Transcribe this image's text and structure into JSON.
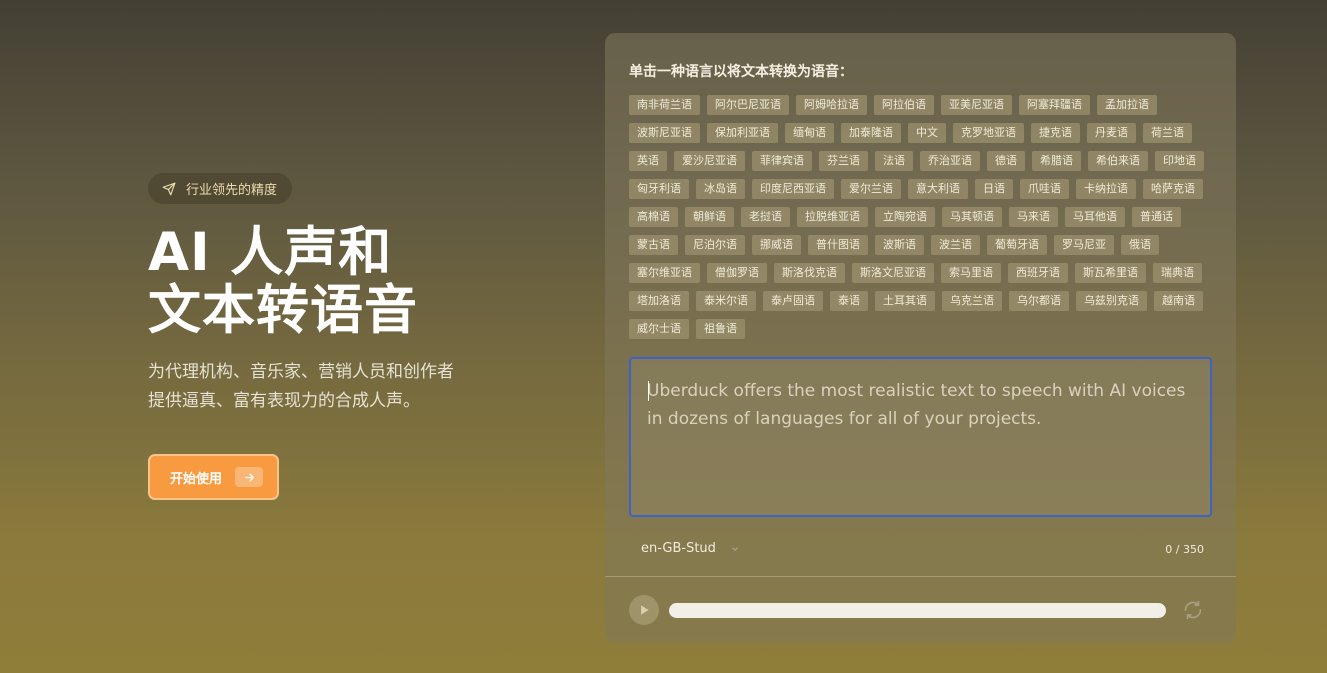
{
  "hero": {
    "badge": "行业领先的精度",
    "title_line1": "AI 人声和",
    "title_line2": "文本转语音",
    "description": "为代理机构、音乐家、营销人员和创作者提供逼真、富有表现力的合成人声。",
    "cta": "开始使用",
    "cta_color": "#f79a40"
  },
  "panel": {
    "title": "单击一种语言以将文本转换为语音：",
    "languages": [
      "南非荷兰语",
      "阿尔巴尼亚语",
      "阿姆哈拉语",
      "阿拉伯语",
      "亚美尼亚语",
      "阿塞拜疆语",
      "孟加拉语",
      "波斯尼亚语",
      "保加利亚语",
      "缅甸语",
      "加泰隆语",
      "中文",
      "克罗地亚语",
      "捷克语",
      "丹麦语",
      "荷兰语",
      "英语",
      "爱沙尼亚语",
      "菲律宾语",
      "芬兰语",
      "法语",
      "乔治亚语",
      "德语",
      "希腊语",
      "希伯来语",
      "印地语",
      "匈牙利语",
      "冰岛语",
      "印度尼西亚语",
      "爱尔兰语",
      "意大利语",
      "日语",
      "爪哇语",
      "卡纳拉语",
      "哈萨克语",
      "高棉语",
      "朝鲜语",
      "老挝语",
      "拉脱维亚语",
      "立陶宛语",
      "马其顿语",
      "马来语",
      "马耳他语",
      "普通话",
      "蒙古语",
      "尼泊尔语",
      "挪威语",
      "普什图语",
      "波斯语",
      "波兰语",
      "葡萄牙语",
      "罗马尼亚",
      "俄语",
      "塞尔维亚语",
      "僧伽罗语",
      "斯洛伐克语",
      "斯洛文尼亚语",
      "索马里语",
      "西班牙语",
      "斯瓦希里语",
      "瑞典语",
      "塔加洛语",
      "泰米尔语",
      "泰卢固语",
      "泰语",
      "土耳其语",
      "乌克兰语",
      "乌尔都语",
      "乌兹别克语",
      "越南语",
      "威尔士语",
      "祖鲁语"
    ],
    "text": "Uberduck offers the most realistic text to speech with AI voices in dozens of languages for all of your projects.",
    "voice": "en-GB-Stud",
    "char_count": "0 / 350",
    "focus_color": "#3d63c7"
  }
}
